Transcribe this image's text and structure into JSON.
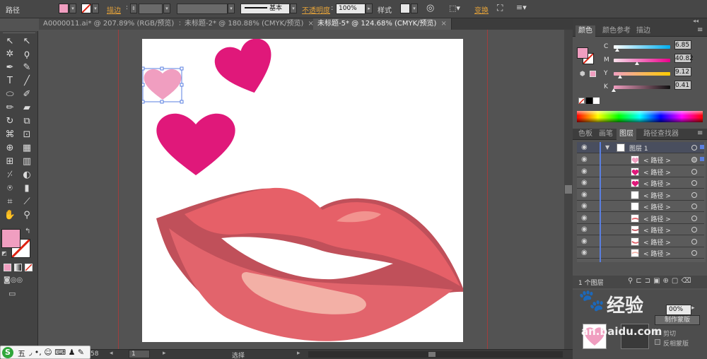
{
  "control_bar": {
    "object_type": "路径",
    "stroke_label": "描边",
    "brush_preset": "基本",
    "opacity_label": "不透明度",
    "opacity_value": "100%",
    "style_label": "样式",
    "transform_label": "变换",
    "fill_color": "#f09ec0"
  },
  "tabs": [
    {
      "label": "A0000011.ai* @ 207.89% (RGB/预览)",
      "close": "×"
    },
    {
      "label": "未标题-2* @ 180.88% (CMYK/预览)",
      "close": "×"
    },
    {
      "label": "未标题-5* @ 124.68% (CMYK/预览)",
      "close": "×"
    }
  ],
  "status": {
    "zoom": "58",
    "page": "1",
    "tool": "选择"
  },
  "color_panel": {
    "tabs": [
      "颜色",
      "颜色参考",
      "描边"
    ],
    "channels": [
      {
        "label": "C",
        "value": "6.85"
      },
      {
        "label": "M",
        "value": "40.82"
      },
      {
        "label": "Y",
        "value": "9.12"
      },
      {
        "label": "K",
        "value": "0.41"
      }
    ],
    "fill_color": "#f09ec0"
  },
  "layers_panel": {
    "tabs": [
      "色板",
      "画笔",
      "图层",
      "路径查找器"
    ],
    "layer_name": "图层 1",
    "paths": [
      "< 路径 >",
      "< 路径 >",
      "< 路径 >",
      "< 路径 >",
      "< 路径 >",
      "< 路径 >",
      "< 路径 >",
      "< 路径 >",
      "< 路径 >"
    ],
    "count_label": "1 个图层"
  },
  "transparency_panel": {
    "opacity": "00%",
    "make_mask": "制作蒙版",
    "clip": "剪切",
    "invert_mask": "反相蒙版"
  },
  "watermark": {
    "text1": "经验",
    "text2": "an.baidu.com"
  },
  "ime_bar": {
    "label": "五"
  }
}
